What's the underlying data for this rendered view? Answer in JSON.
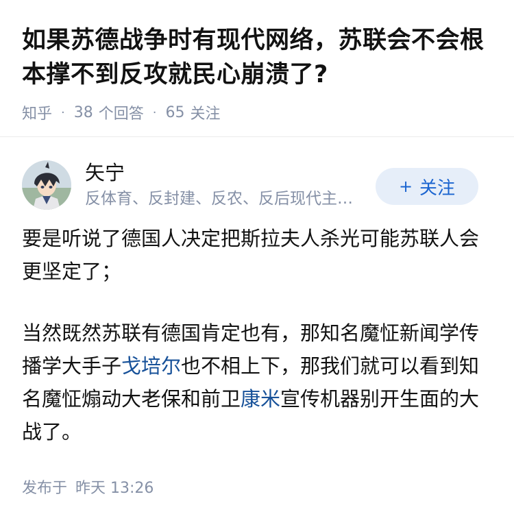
{
  "question": {
    "title": "如果苏德战争时有现代网络，苏联会不会根本撑不到反攻就民心崩溃了?",
    "source": "知乎",
    "answer_count": "38",
    "answer_label": "个回答",
    "follow_count": "65",
    "follow_label": "关注"
  },
  "author": {
    "name": "矢宁",
    "bio": "反体育、反封建、反农、反后现代主义、反资本主义",
    "avatar_icon": "anime-avatar-icon",
    "follow_button": "关注"
  },
  "answer": {
    "paragraph1": "要是听说了德国人决定把斯拉夫人杀光可能苏联人会更坚定了；",
    "paragraph2": {
      "part1": "当然既然苏联有德国肯定也有，那知名魔怔新闻学传播学大手子",
      "link1": "戈培尔",
      "part2": "也不相上下，那我们就可以看到知名魔怔煽动大老保和前卫",
      "link2": "康米",
      "part3": "宣传机器别开生面的大战了。"
    }
  },
  "footer": {
    "published_label": "发布于",
    "published_time": "昨天 13:26"
  },
  "colors": {
    "link": "#175199",
    "meta": "#8590a6",
    "follow_bg": "#e6eef9",
    "follow_text": "#1a64d0"
  }
}
